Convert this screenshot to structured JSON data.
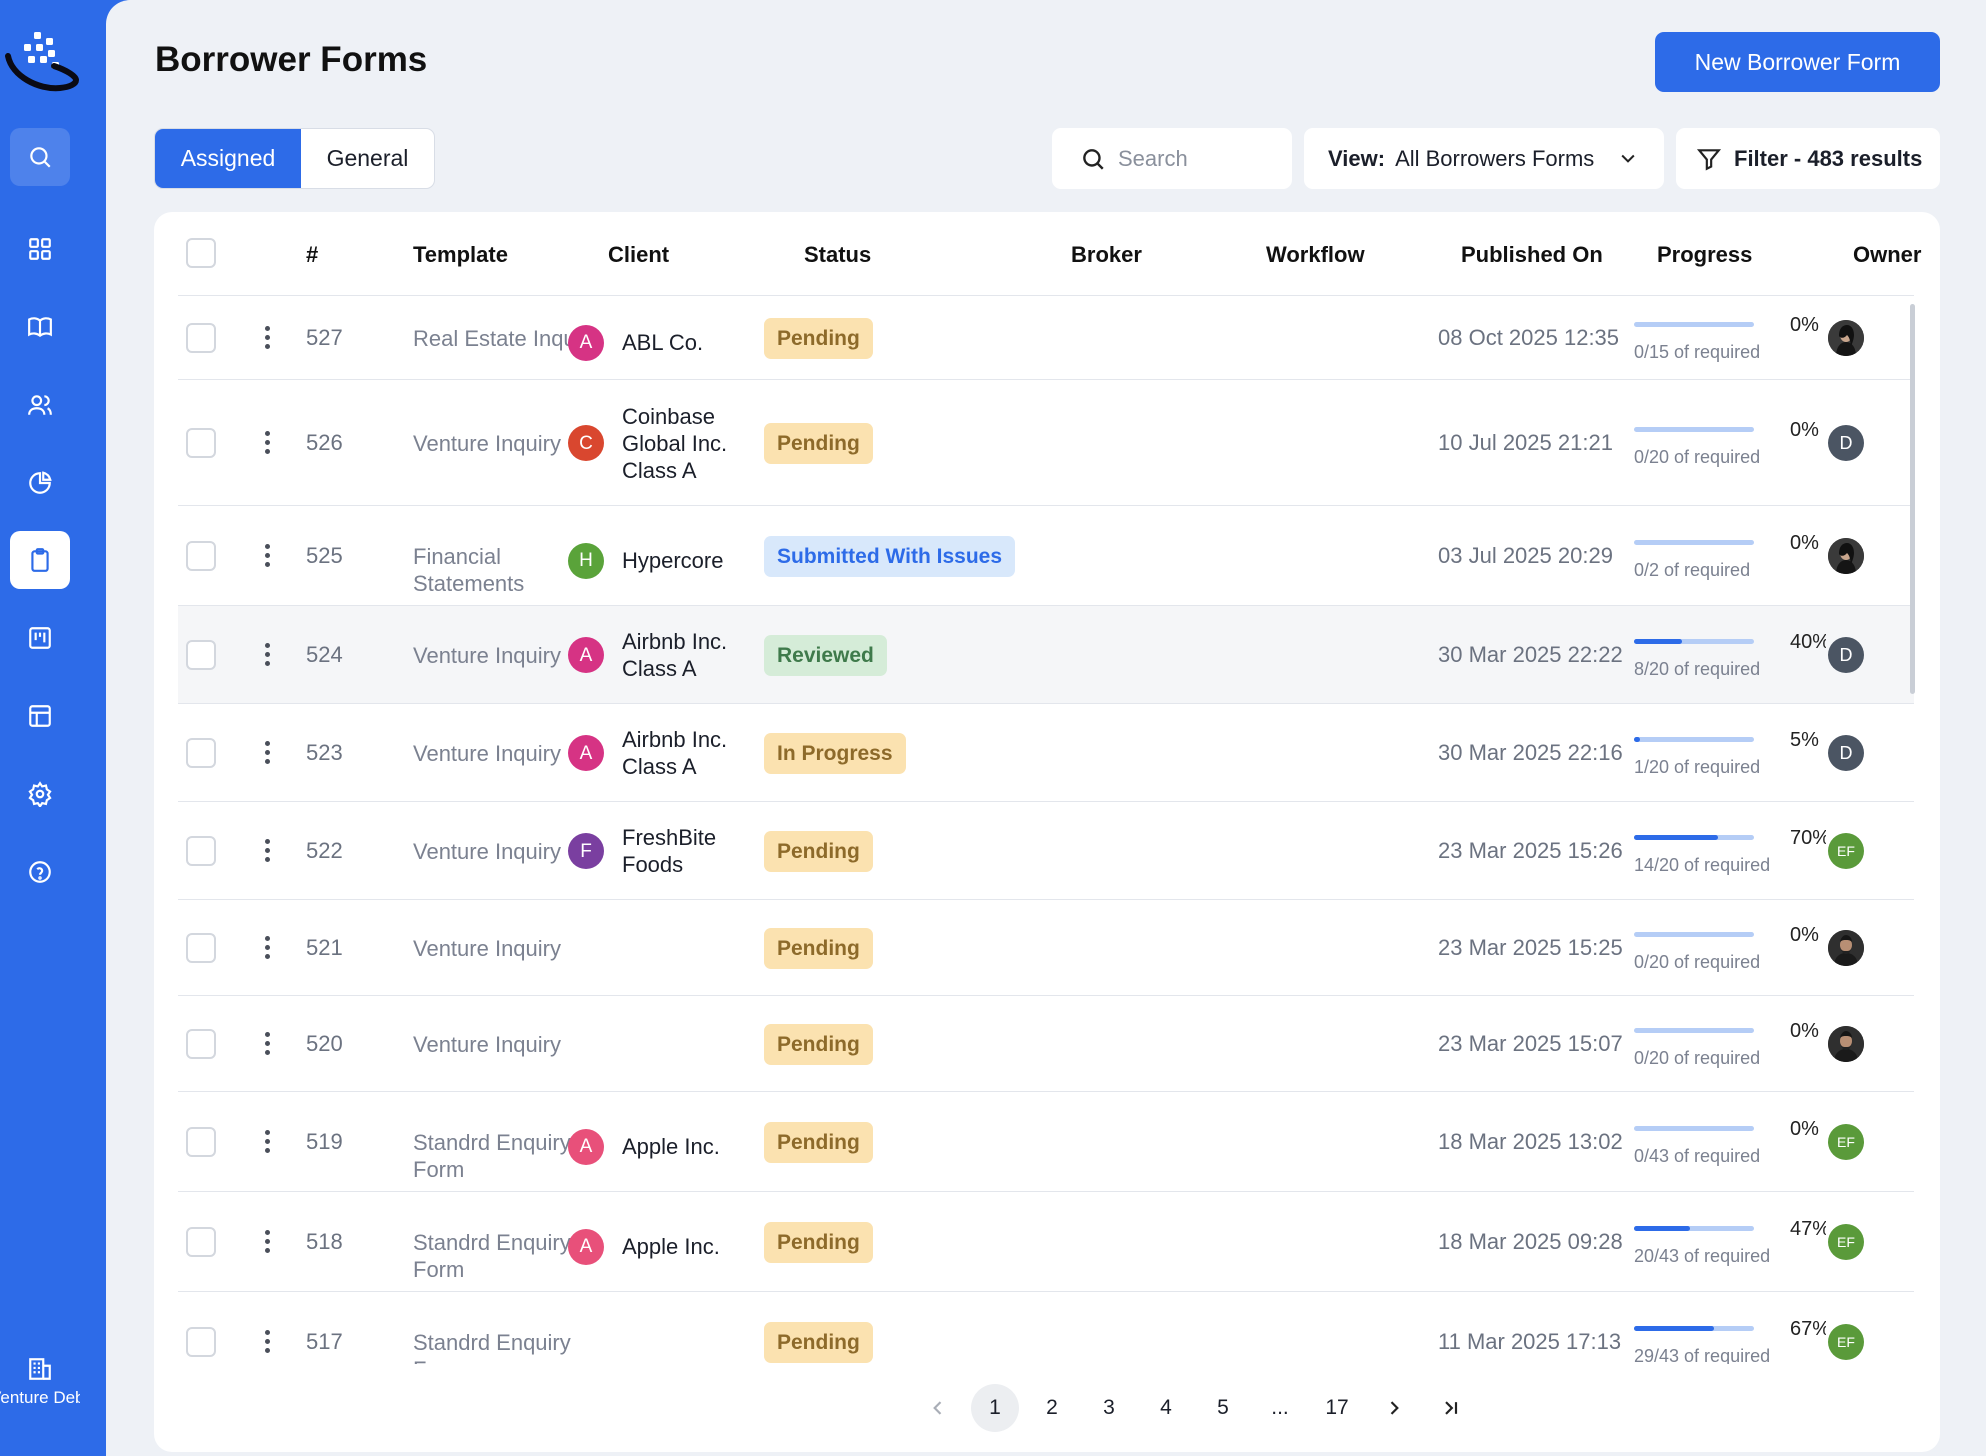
{
  "sidebar": {
    "nav": [
      {
        "name": "search-nav",
        "icon": "search-icon"
      },
      {
        "name": "dashboard-nav",
        "icon": "grid-icon"
      },
      {
        "name": "library-nav",
        "icon": "book-icon"
      },
      {
        "name": "users-nav",
        "icon": "users-icon"
      },
      {
        "name": "reports-nav",
        "icon": "pie-chart-icon"
      },
      {
        "name": "forms-nav",
        "icon": "clipboard-icon"
      },
      {
        "name": "board-nav",
        "icon": "kanban-icon"
      },
      {
        "name": "table-nav",
        "icon": "table-icon"
      },
      {
        "name": "settings-nav",
        "icon": "gear-icon"
      },
      {
        "name": "help-nav",
        "icon": "help-icon"
      }
    ],
    "workspace": {
      "name": "Venture Debt Demo",
      "icon": "building-icon"
    }
  },
  "header": {
    "title": "Borrower Forms",
    "new_button": "New Borrower Form"
  },
  "tabs": {
    "assigned": "Assigned",
    "general": "General",
    "active": "Assigned"
  },
  "toolbar": {
    "search_placeholder": "Search",
    "view_label": "View:",
    "view_value": "All Borrowers Forms",
    "filter_label": "Filter - 483 results"
  },
  "table": {
    "columns": {
      "num": "#",
      "template": "Template",
      "client": "Client",
      "status": "Status",
      "broker": "Broker",
      "workflow": "Workflow",
      "published": "Published On",
      "progress": "Progress",
      "owner": "Owner"
    },
    "rows": [
      {
        "num": "527",
        "template": "Real Estate Inquiry",
        "client": "ABL Co.",
        "client_initial": "A",
        "client_color": "#d63384",
        "status": "Pending",
        "status_kind": "pending",
        "published": "08 Oct 2025 12:35",
        "progress": 0,
        "pct": "0%",
        "required": "0/15 of required",
        "owner": "photo-woman"
      },
      {
        "num": "526",
        "template": "Venture Inquiry",
        "client": "Coinbase Global Inc. Class A",
        "client_initial": "C",
        "client_color": "#d9472f",
        "status": "Pending",
        "status_kind": "pending",
        "published": "10 Jul 2025 21:21",
        "progress": 0,
        "pct": "0%",
        "required": "0/20 of required",
        "owner": "D"
      },
      {
        "num": "525",
        "template": "Financial Statements",
        "client": "Hypercore",
        "client_initial": "H",
        "client_color": "#5aa33a",
        "status": "Submitted With Issues",
        "status_kind": "issues",
        "published": "03 Jul 2025 20:29",
        "progress": 0,
        "pct": "0%",
        "required": "0/2 of required",
        "owner": "photo-woman"
      },
      {
        "num": "524",
        "template": "Venture Inquiry",
        "client": "Airbnb Inc. Class A",
        "client_initial": "A",
        "client_color": "#d63384",
        "status": "Reviewed",
        "status_kind": "reviewed",
        "published": "30 Mar 2025 22:22",
        "progress": 40,
        "pct": "40%",
        "required": "8/20 of required",
        "owner": "D"
      },
      {
        "num": "523",
        "template": "Venture Inquiry",
        "client": "Airbnb Inc. Class A",
        "client_initial": "A",
        "client_color": "#d63384",
        "status": "In Progress",
        "status_kind": "progress",
        "published": "30 Mar 2025 22:16",
        "progress": 5,
        "pct": "5%",
        "required": "1/20 of required",
        "owner": "D"
      },
      {
        "num": "522",
        "template": "Venture Inquiry",
        "client": "FreshBite Foods",
        "client_initial": "F",
        "client_color": "#7a3fa0",
        "status": "Pending",
        "status_kind": "pending",
        "published": "23 Mar 2025 15:26",
        "progress": 70,
        "pct": "70%",
        "required": "14/20 of required",
        "owner": "EF"
      },
      {
        "num": "521",
        "template": "Venture Inquiry",
        "client": "",
        "client_initial": "",
        "client_color": "",
        "status": "Pending",
        "status_kind": "pending",
        "published": "23 Mar 2025 15:25",
        "progress": 0,
        "pct": "0%",
        "required": "0/20 of required",
        "owner": "photo-man"
      },
      {
        "num": "520",
        "template": "Venture Inquiry",
        "client": "",
        "client_initial": "",
        "client_color": "",
        "status": "Pending",
        "status_kind": "pending",
        "published": "23 Mar 2025 15:07",
        "progress": 0,
        "pct": "0%",
        "required": "0/20 of required",
        "owner": "photo-man"
      },
      {
        "num": "519",
        "template": "Standrd Enquiry Form",
        "client": "Apple Inc.",
        "client_initial": "A",
        "client_color": "#e8507a",
        "status": "Pending",
        "status_kind": "pending",
        "published": "18 Mar 2025 13:02",
        "progress": 0,
        "pct": "0%",
        "required": "0/43 of required",
        "owner": "EF"
      },
      {
        "num": "518",
        "template": "Standrd Enquiry Form",
        "client": "Apple Inc.",
        "client_initial": "A",
        "client_color": "#e8507a",
        "status": "Pending",
        "status_kind": "pending",
        "published": "18 Mar 2025 09:28",
        "progress": 47,
        "pct": "47%",
        "required": "20/43 of required",
        "owner": "EF"
      },
      {
        "num": "517",
        "template": "Standrd Enquiry Form",
        "client": "",
        "client_initial": "",
        "client_color": "",
        "status": "Pending",
        "status_kind": "pending",
        "published": "11 Mar 2025 17:13",
        "progress": 67,
        "pct": "67%",
        "required": "29/43 of required",
        "owner": "EF"
      }
    ]
  },
  "pagination": {
    "pages": [
      "1",
      "2",
      "3",
      "4",
      "5",
      "...",
      "17"
    ],
    "current": "1"
  }
}
